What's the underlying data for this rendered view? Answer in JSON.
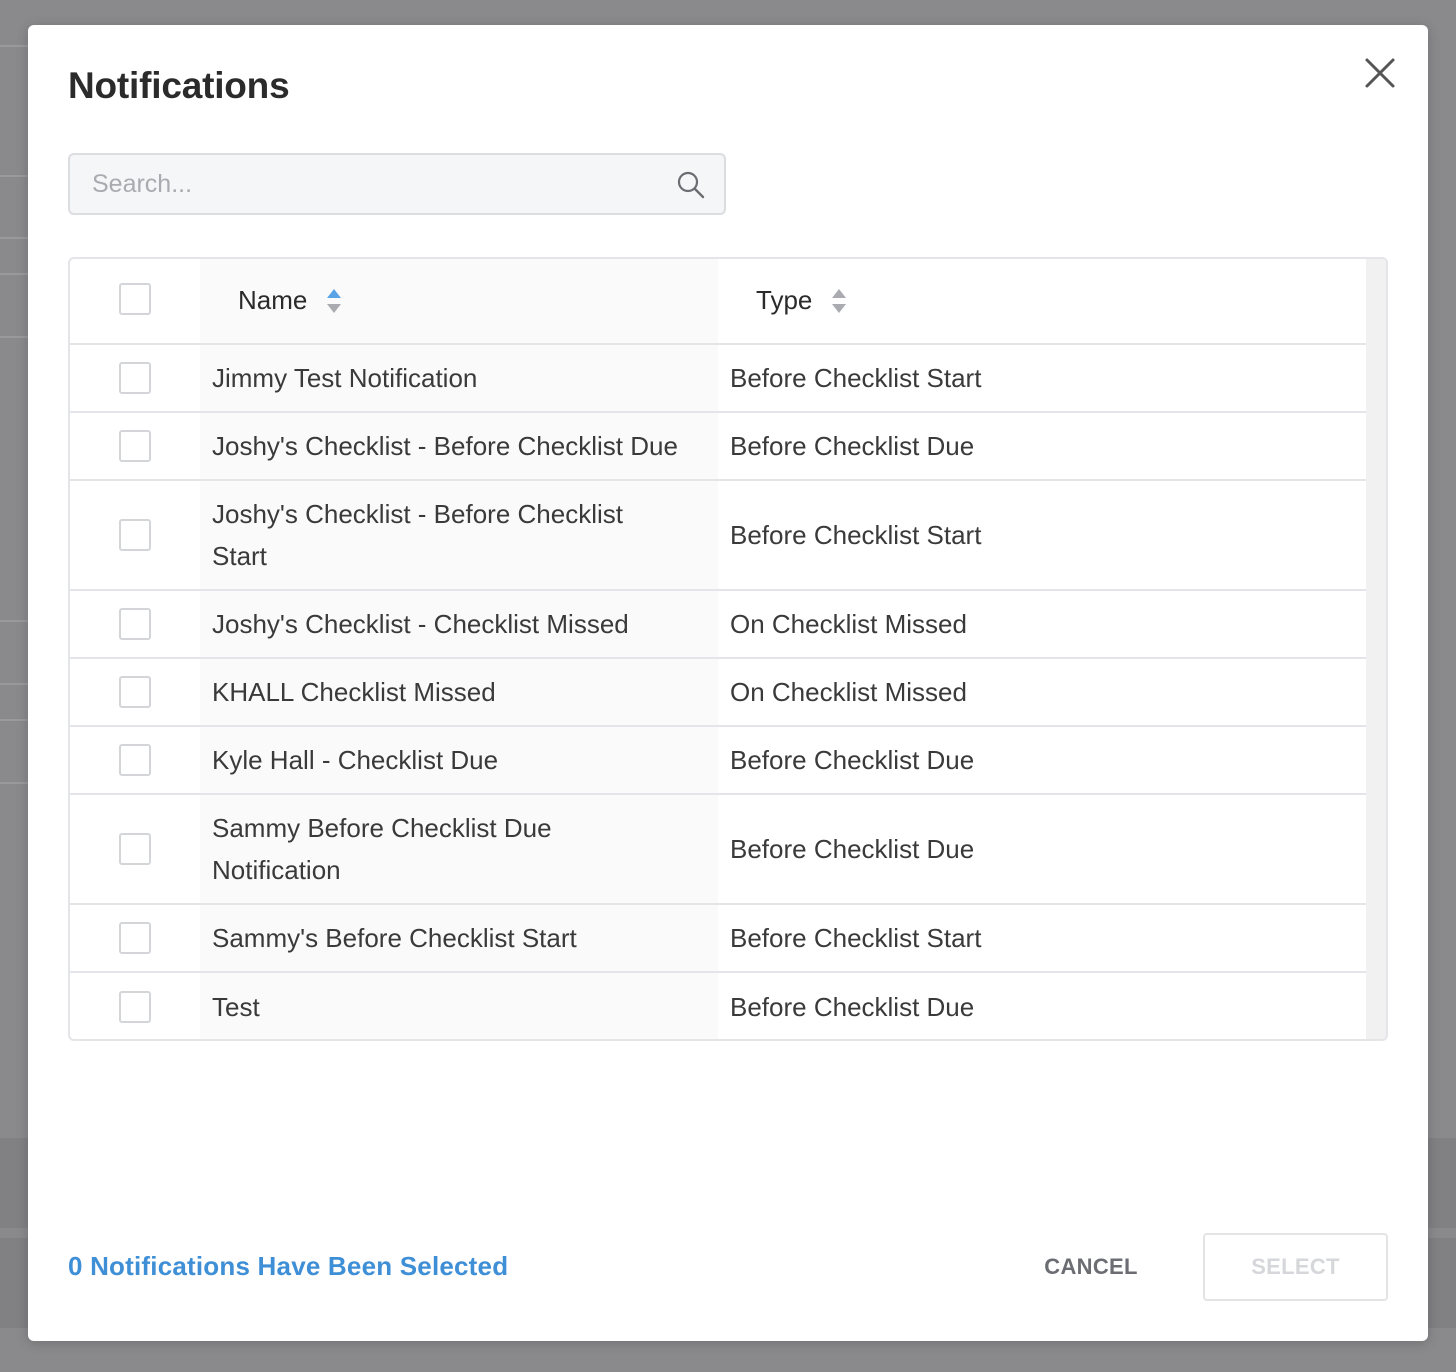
{
  "modal": {
    "title": "Notifications",
    "close_icon": "close-icon"
  },
  "search": {
    "placeholder": "Search...",
    "value": "",
    "icon": "search-icon"
  },
  "table": {
    "columns": [
      {
        "label": "Name",
        "sort": "ascending",
        "sort_icon": "sort-icon"
      },
      {
        "label": "Type",
        "sort": "none",
        "sort_icon": "sort-icon"
      }
    ],
    "rows": [
      {
        "name": "Jimmy Test Notification",
        "type": "Before Checklist Start",
        "checked": false
      },
      {
        "name": "Joshy's Checklist - Before Checklist Due",
        "type": "Before Checklist Due",
        "checked": false
      },
      {
        "name": "Joshy's Checklist - Before Checklist Start",
        "type": "Before Checklist Start",
        "checked": false
      },
      {
        "name": "Joshy's Checklist - Checklist Missed",
        "type": "On Checklist Missed",
        "checked": false
      },
      {
        "name": "KHALL Checklist Missed",
        "type": "On Checklist Missed",
        "checked": false
      },
      {
        "name": "Kyle Hall - Checklist Due",
        "type": "Before Checklist Due",
        "checked": false
      },
      {
        "name": "Sammy Before Checklist Due Notification",
        "type": "Before Checklist Due",
        "checked": false
      },
      {
        "name": "Sammy's Before Checklist Start",
        "type": "Before Checklist Start",
        "checked": false
      },
      {
        "name": "Test",
        "type": "Before Checklist Due",
        "checked": false
      }
    ]
  },
  "footer": {
    "selected_count_text": "0 Notifications Have Been Selected",
    "cancel_label": "CANCEL",
    "select_label": "SELECT",
    "select_enabled": false
  },
  "colors": {
    "accent": "#3f8fd6",
    "overlay": "#8a8a8c",
    "sort_active": "#5aa3e6",
    "sort_inactive": "#a9abb0"
  }
}
